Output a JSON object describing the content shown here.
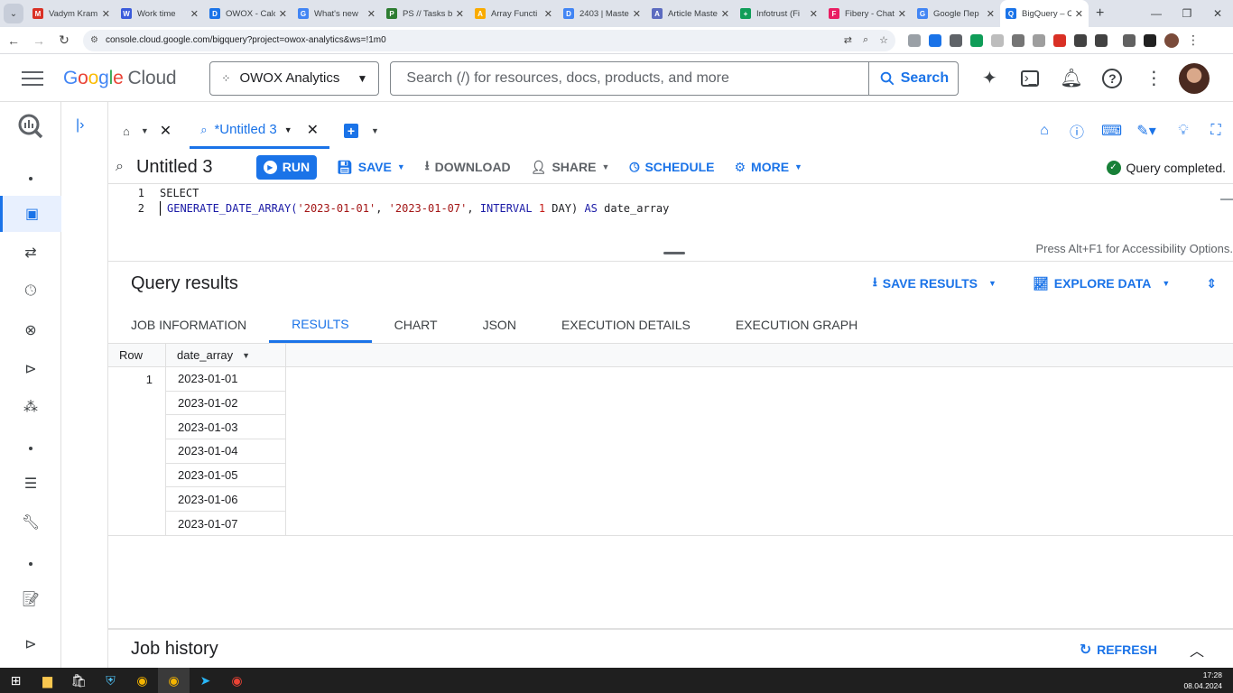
{
  "browser": {
    "tabs": [
      {
        "title": "Vadym Kram",
        "color": "#d93025",
        "letter": "M"
      },
      {
        "title": "Work time",
        "color": "#3b5bdb",
        "letter": "W"
      },
      {
        "title": "OWOX - Calc",
        "color": "#1a73e8",
        "letter": "D"
      },
      {
        "title": "What's new",
        "color": "#4285f4",
        "letter": "G"
      },
      {
        "title": "PS // Tasks b",
        "color": "#2e7d32",
        "letter": "P"
      },
      {
        "title": "Array Functi",
        "color": "#f9ab00",
        "letter": "A"
      },
      {
        "title": "2403 | Maste",
        "color": "#4285f4",
        "letter": "D"
      },
      {
        "title": "Article Maste",
        "color": "#5c6bc0",
        "letter": "A"
      },
      {
        "title": "Infotrust (Fi",
        "color": "#0f9d58",
        "letter": "+"
      },
      {
        "title": "Fibery - Chat",
        "color": "#e91e63",
        "letter": "F"
      },
      {
        "title": "Google Пер",
        "color": "#4285f4",
        "letter": "G"
      },
      {
        "title": "BigQuery – C",
        "color": "#1a73e8",
        "letter": "Q",
        "active": true
      }
    ],
    "url": "console.cloud.google.com/bigquery?project=owox-analytics&ws=!1m0"
  },
  "header": {
    "logo_google": "Google",
    "logo_cloud": "Cloud",
    "project": "OWOX Analytics",
    "search_placeholder": "Search (/) for resources, docs, products, and more",
    "search_button": "Search"
  },
  "editor_tabs": {
    "active_tab": "*Untitled 3"
  },
  "toolbar": {
    "title": "Untitled 3",
    "run": "RUN",
    "save": "SAVE",
    "download": "DOWNLOAD",
    "share": "SHARE",
    "schedule": "SCHEDULE",
    "more": "MORE",
    "status": "Query completed."
  },
  "editor": {
    "line1_no": "1",
    "line2_no": "2",
    "line1": "SELECT",
    "fn": "GENERATE_DATE_ARRAY(",
    "arg1": "'2023-01-01'",
    "comma1": ", ",
    "arg2": "'2023-01-07'",
    "comma2": ", ",
    "interval_kw": "INTERVAL",
    "space": " ",
    "one": "1",
    "day": " DAY) ",
    "as_kw": "AS",
    "alias": " date_array",
    "accessibility": "Press Alt+F1 for Accessibility Options."
  },
  "results": {
    "title": "Query results",
    "save_results": "SAVE RESULTS",
    "explore_data": "EXPLORE DATA",
    "tabs": {
      "job_information": "JOB INFORMATION",
      "results": "RESULTS",
      "chart": "CHART",
      "json": "JSON",
      "execution_details": "EXECUTION DETAILS",
      "execution_graph": "EXECUTION GRAPH"
    },
    "columns": {
      "row": "Row",
      "date_array": "date_array"
    },
    "row_number": "1",
    "values": [
      "2023-01-01",
      "2023-01-02",
      "2023-01-03",
      "2023-01-04",
      "2023-01-05",
      "2023-01-06",
      "2023-01-07"
    ]
  },
  "job_history": {
    "title": "Job history",
    "refresh": "REFRESH"
  },
  "taskbar": {
    "time": "17:28",
    "date": "08.04.2024"
  }
}
